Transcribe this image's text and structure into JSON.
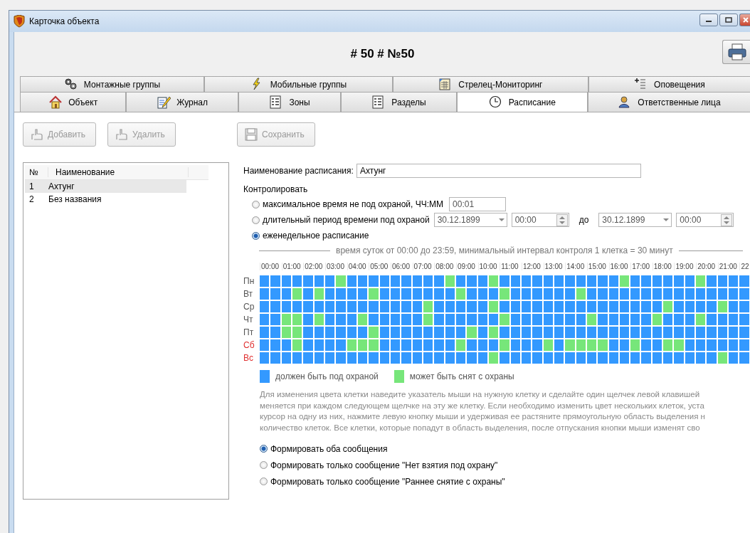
{
  "window": {
    "title": "Карточка объекта"
  },
  "header": {
    "title": "# 50 # №50"
  },
  "tabs_top": [
    {
      "label": "Монтажные группы",
      "selected": false
    },
    {
      "label": "Мобильные группы",
      "selected": false
    },
    {
      "label": "Стрелец-Мониторинг",
      "selected": false
    },
    {
      "label": "Оповещения",
      "selected": false
    }
  ],
  "tabs_bottom": [
    {
      "label": "Объект",
      "selected": false
    },
    {
      "label": "Журнал",
      "selected": false
    },
    {
      "label": "Зоны",
      "selected": false
    },
    {
      "label": "Разделы",
      "selected": false
    },
    {
      "label": "Расписание",
      "selected": true
    },
    {
      "label": "Ответственные лица",
      "selected": false
    }
  ],
  "list_buttons": [
    {
      "label": "Добавить",
      "disabled": true
    },
    {
      "label": "Удалить",
      "disabled": true
    }
  ],
  "save_button": {
    "label": "Сохранить",
    "disabled": true
  },
  "schedule_list": {
    "columns": [
      "№",
      "Наименование"
    ],
    "rows": [
      {
        "number": "1",
        "name": "Ахтунг",
        "selected": true
      },
      {
        "number": "2",
        "name": "Без названия",
        "selected": false
      }
    ]
  },
  "form": {
    "name_label": "Наименование расписания:",
    "name_value": "Ахтунг",
    "control_label": "Контролировать",
    "modes": [
      {
        "kind": "duration",
        "label": "максимальное время не под охраной, ЧЧ:ММ",
        "selected": false,
        "value": "00:01"
      },
      {
        "kind": "period",
        "label": "длительный период времени под охраной",
        "selected": false,
        "from_date": "30.12.1899",
        "from_time": "00:00",
        "to_label": "до",
        "to_date": "30.12.1899",
        "to_time": "00:00"
      },
      {
        "kind": "weekly",
        "label": "еженедельное расписание",
        "selected": true
      }
    ],
    "grid_caption": "время суток от 00:00 до 23:59, минимальный интервал контроля 1 клетка = 30 минут",
    "hours": [
      "00:00",
      "01:00",
      "02:00",
      "03:00",
      "04:00",
      "05:00",
      "06:00",
      "07:00",
      "08:00",
      "09:00",
      "10:00",
      "11:00",
      "12:00",
      "13:00",
      "14:00",
      "15:00",
      "16:00",
      "17:00",
      "18:00",
      "19:00",
      "20:00",
      "21:00",
      "22"
    ],
    "days": [
      {
        "label": "Пн",
        "weekend": false,
        "cells": [
          false,
          false,
          false,
          false,
          false,
          false,
          false,
          true,
          false,
          false,
          false,
          false,
          false,
          false,
          false,
          false,
          false,
          true,
          false,
          false,
          false,
          true,
          false,
          false,
          false,
          false,
          false,
          false,
          false,
          false,
          false,
          false,
          false,
          true,
          false,
          false,
          false,
          false,
          false,
          false,
          true,
          false,
          false,
          false,
          false
        ]
      },
      {
        "label": "Вт",
        "weekend": false,
        "cells": [
          false,
          false,
          false,
          true,
          false,
          true,
          false,
          false,
          false,
          false,
          true,
          false,
          false,
          false,
          false,
          false,
          false,
          false,
          true,
          false,
          false,
          false,
          true,
          false,
          false,
          false,
          false,
          false,
          false,
          true,
          false,
          false,
          false,
          false,
          false,
          false,
          false,
          false,
          false,
          false,
          false,
          false,
          false,
          false,
          false
        ]
      },
      {
        "label": "Ср",
        "weekend": false,
        "cells": [
          false,
          false,
          false,
          false,
          false,
          false,
          false,
          false,
          false,
          false,
          false,
          false,
          false,
          false,
          false,
          true,
          false,
          false,
          false,
          false,
          false,
          true,
          false,
          false,
          false,
          false,
          false,
          false,
          false,
          false,
          false,
          false,
          false,
          false,
          false,
          false,
          false,
          true,
          false,
          false,
          false,
          false,
          true,
          false,
          false
        ]
      },
      {
        "label": "Чт",
        "weekend": false,
        "cells": [
          false,
          false,
          true,
          true,
          false,
          true,
          false,
          false,
          false,
          true,
          false,
          false,
          false,
          false,
          false,
          true,
          false,
          false,
          false,
          false,
          false,
          false,
          true,
          false,
          false,
          false,
          false,
          false,
          false,
          false,
          true,
          false,
          false,
          false,
          false,
          false,
          true,
          false,
          false,
          false,
          true,
          false,
          false,
          false,
          false
        ]
      },
      {
        "label": "Пт",
        "weekend": false,
        "cells": [
          false,
          false,
          true,
          true,
          false,
          false,
          false,
          false,
          false,
          false,
          true,
          false,
          false,
          false,
          false,
          false,
          false,
          false,
          false,
          true,
          false,
          true,
          false,
          false,
          false,
          false,
          false,
          false,
          false,
          false,
          false,
          false,
          false,
          false,
          false,
          false,
          false,
          false,
          false,
          false,
          false,
          false,
          false,
          false,
          false
        ]
      },
      {
        "label": "Сб",
        "weekend": true,
        "cells": [
          false,
          false,
          false,
          true,
          false,
          false,
          false,
          false,
          true,
          true,
          true,
          false,
          false,
          false,
          false,
          false,
          false,
          false,
          true,
          false,
          false,
          false,
          true,
          false,
          false,
          false,
          true,
          false,
          true,
          true,
          true,
          true,
          false,
          false,
          true,
          false,
          false,
          true,
          true,
          false,
          false,
          false,
          false,
          false,
          false
        ]
      },
      {
        "label": "Вс",
        "weekend": true,
        "cells": [
          false,
          false,
          false,
          false,
          false,
          false,
          false,
          false,
          false,
          false,
          false,
          false,
          false,
          false,
          false,
          false,
          false,
          false,
          false,
          false,
          false,
          true,
          false,
          false,
          false,
          false,
          false,
          false,
          false,
          false,
          false,
          false,
          false,
          false,
          false,
          false,
          false,
          false,
          false,
          false,
          false,
          false,
          true,
          false,
          false
        ]
      }
    ],
    "legend": [
      {
        "label": "должен быть под охраной",
        "color": "#3399ff"
      },
      {
        "label": "может быть снят с охраны",
        "color": "#77e67a"
      }
    ],
    "help_lines": [
      "Для изменения цвета клетки наведите указатель мыши на нужную клетку и сделайте один щелчек левой клавишей",
      "меняется при каждом следующем щелчке на эту же клетку. Если необходимо изменить цвет нескольких клеток, уста",
      "курсор на одну из них, нажмите левую кнопку мыши и удерживая ее растяните прямоугольную область выделения н",
      "количество клеток. Все клетки, которые попадут в область выделения, после отпускания кнопки мыши изменят сво"
    ],
    "message_options": [
      {
        "label": "Формировать оба сообщения",
        "selected": true
      },
      {
        "label": "Формировать только сообщение \"Нет взятия под охрану\"",
        "selected": false
      },
      {
        "label": "Формировать только сообщение \"Раннее снятие с охраны\"",
        "selected": false
      }
    ]
  }
}
